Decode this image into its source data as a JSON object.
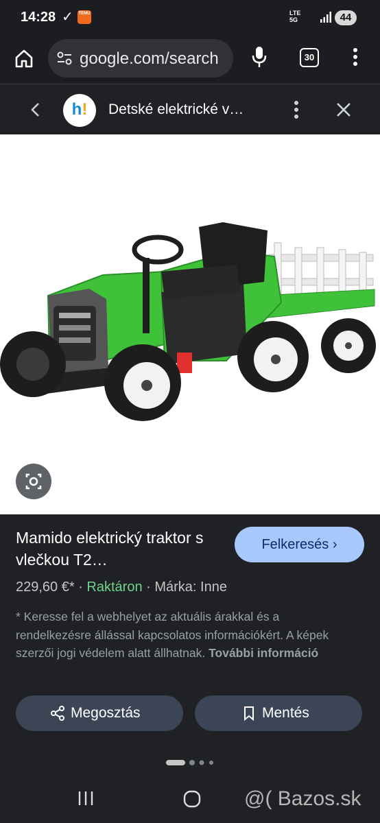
{
  "status_bar": {
    "time": "14:28",
    "temu": "TEMU",
    "network": "5G",
    "lte": "LTE",
    "battery": "44"
  },
  "browser": {
    "url": "google.com/search",
    "tab_count": "30"
  },
  "sheet": {
    "site_title": "Detské elektrické v…"
  },
  "product": {
    "title": "Mamido elektrický traktor s vlečkou T2…",
    "find_button": "Felkeresés",
    "price": "229,60 €*",
    "separator": " · ",
    "stock": "Raktáron",
    "brand": "Márka: Inne",
    "disclaimer": "* Keresse fel a webhelyet az aktuális árakkal és a rendelkezésre állással kapcsolatos információkért. A képek szerzői jogi védelem alatt állhatnak.",
    "more_info": "További információ"
  },
  "actions": {
    "share": "Megosztás",
    "save": "Mentés"
  },
  "watermark": "@( Bazos.sk",
  "colors": {
    "background": "#1f2125",
    "accent_button": "#a8c7fa",
    "stock_green": "#6dd58c",
    "action_button": "#3c4556",
    "tractor_green": "#3fc23a"
  }
}
